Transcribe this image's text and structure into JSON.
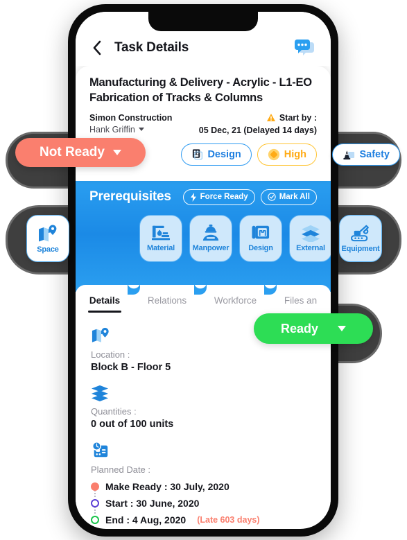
{
  "appbar": {
    "title": "Task Details",
    "back_icon": "chevron-left-icon",
    "chat_icon": "chat-bubbles-icon"
  },
  "task": {
    "title": "Manufacturing & Delivery - Acrylic - L1-EO Fabrication of Tracks & Columns",
    "company": "Simon Construction",
    "person": "Hank Griffin",
    "start_by_label": "Start by :",
    "start_by_date": "05 Dec, 21 (Delayed 14 days)",
    "warning_icon": "warning-triangle-icon"
  },
  "status": {
    "not_ready_label": "Not Ready",
    "not_ready_color": "#fa7f6e",
    "ready_label": "Ready",
    "ready_color": "#2ddd55"
  },
  "chips": [
    {
      "label": "Design",
      "icon": "blueprint-icon",
      "color": "#1f7fe0"
    },
    {
      "label": "High",
      "icon": "diamond-icon",
      "color": "#ffab16"
    },
    {
      "label": "Safety",
      "icon": "safety-cone-icon",
      "color": "#1f7fe0"
    }
  ],
  "prerequisites": {
    "title": "Prerequisites",
    "force_ready_label": "Force Ready",
    "force_ready_icon": "lightning-bolt-icon",
    "mark_all_label": "Mark All",
    "mark_all_icon": "check-circle-icon",
    "panel_color": "#2b9ff0",
    "cards": [
      {
        "label": "Space",
        "icon": "map-pin-icon"
      },
      {
        "label": "Material",
        "icon": "material-bucket-icon"
      },
      {
        "label": "Manpower",
        "icon": "worker-helmet-icon"
      },
      {
        "label": "Design",
        "icon": "blueprint-roll-icon"
      },
      {
        "label": "External",
        "icon": "layers-icon"
      },
      {
        "label": "Equipment",
        "icon": "crane-excavator-icon"
      }
    ]
  },
  "tabs": [
    {
      "label": "Details",
      "active": true
    },
    {
      "label": "Relations",
      "active": false
    },
    {
      "label": "Workforce",
      "active": false
    },
    {
      "label": "Files an",
      "active": false
    }
  ],
  "details": {
    "location_icon": "map-pin-icon",
    "location_label": "Location :",
    "location_value": "Block B - Floor 5",
    "quantities_icon": "layers-icon",
    "quantities_label": "Quantities :",
    "quantities_value": "0 out of 100 units",
    "planned_icon": "calendar-clock-icon",
    "planned_label": "Planned Date :",
    "dates": [
      {
        "text": "Make Ready : 30 July, 2020",
        "dot": "filled",
        "note": ""
      },
      {
        "text": "Start : 30 June, 2020",
        "dot": "ring-purple",
        "note": ""
      },
      {
        "text": "End : 4 Aug, 2020",
        "dot": "ring-green",
        "note": "(Late 603 days)"
      }
    ]
  }
}
